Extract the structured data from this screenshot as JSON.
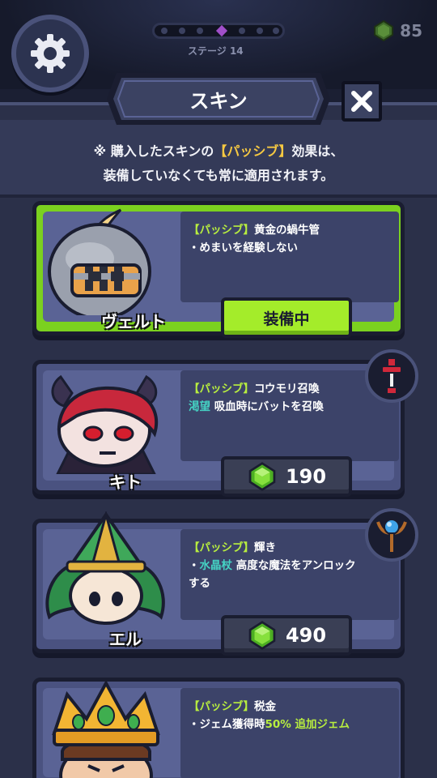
{
  "hud": {
    "stage_label": "ステージ 14",
    "gem_count": "85",
    "icons": [
      "gear-icon",
      "gem-icon"
    ]
  },
  "header": {
    "title": "スキン",
    "close_icon": "close-icon"
  },
  "notice": {
    "prefix": "※ 購入したスキンの",
    "bracket": "【パッシブ】",
    "suffix": "効果は、",
    "line2": "装備していなくても常に適用されます。"
  },
  "skins": [
    {
      "name": "ヴェルト",
      "passive_tag": "【パッシブ】",
      "passive_name": "黄金の蝸牛管",
      "desc_prefix": "・",
      "desc_highlight": "",
      "desc_text": "めまいを経験しない",
      "status": "装備中",
      "equipped": true
    },
    {
      "name": "キト",
      "passive_tag": "【パッシブ】",
      "passive_name": "コウモリ召喚",
      "desc_prefix": "",
      "desc_highlight": "渇望",
      "desc_text": "吸血時にバットを召喚",
      "price": "190",
      "equipped": false,
      "badge_icon": "sword-icon"
    },
    {
      "name": "エル",
      "passive_tag": "【パッシブ】",
      "passive_name": "輝き",
      "desc_prefix": "・",
      "desc_highlight": "水晶杖",
      "desc_text": "高度な魔法をアンロック",
      "desc_text2": "する",
      "price": "490",
      "equipped": false,
      "badge_icon": "crystal-staff-icon"
    },
    {
      "name": "",
      "passive_tag": "【パッシブ】",
      "passive_name": "税金",
      "desc_prefix": "・",
      "desc_text": "ジェム獲得時",
      "desc_green": "50% 追加ジェム",
      "equipped": false
    }
  ],
  "colors": {
    "accent_green": "#7bd11f",
    "passive_tag": "#b8ee3f",
    "highlight_teal": "#45d3c4",
    "notice_bracket": "#f5c842",
    "card_bg": "#4a5280"
  }
}
